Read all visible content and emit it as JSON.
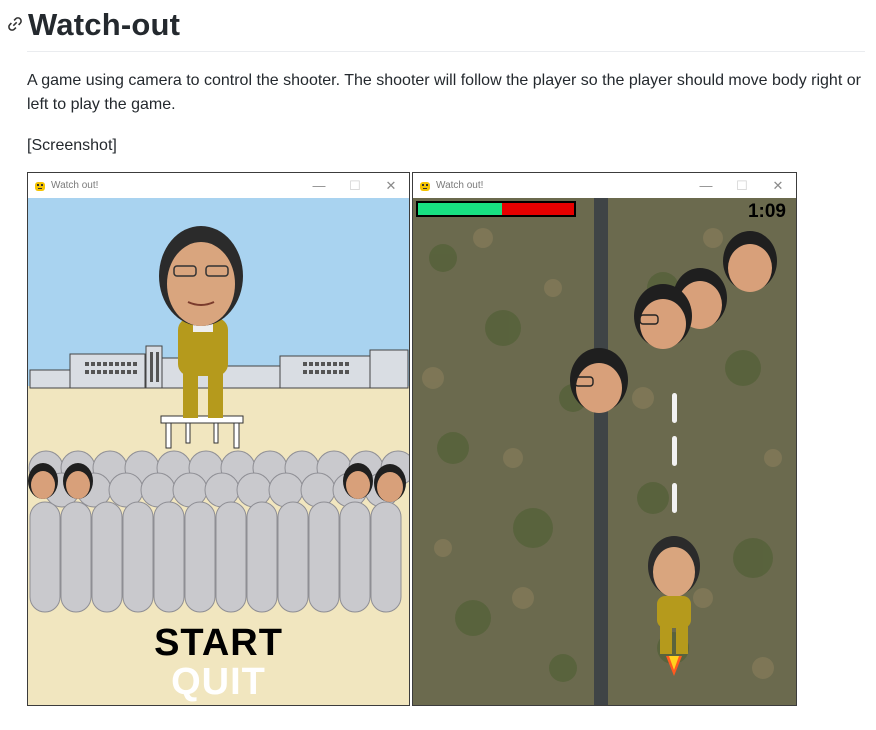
{
  "readme": {
    "title": "Watch-out",
    "description": "A game using camera to control the shooter. The shooter will follow the player so the player should move body right or left to play the game.",
    "screenshot_label": "[Screenshot]"
  },
  "windows": [
    {
      "title": "Watch out!",
      "menu": {
        "start_label": "START",
        "quit_label": "QUIT"
      }
    },
    {
      "title": "Watch out!",
      "hud": {
        "timer": "1:09",
        "health_fraction": 0.54
      }
    }
  ],
  "icons": {
    "anchor": "link-icon",
    "app": "pygame-snake-icon",
    "minimize": "minimize-icon",
    "maximize": "maximize-icon",
    "close": "close-icon"
  },
  "colors": {
    "sky": "#a9d3f0",
    "ground": "#f1e6bf",
    "health_good": "#18e081",
    "health_bad": "#e60000",
    "suit": "#b59a1c"
  }
}
